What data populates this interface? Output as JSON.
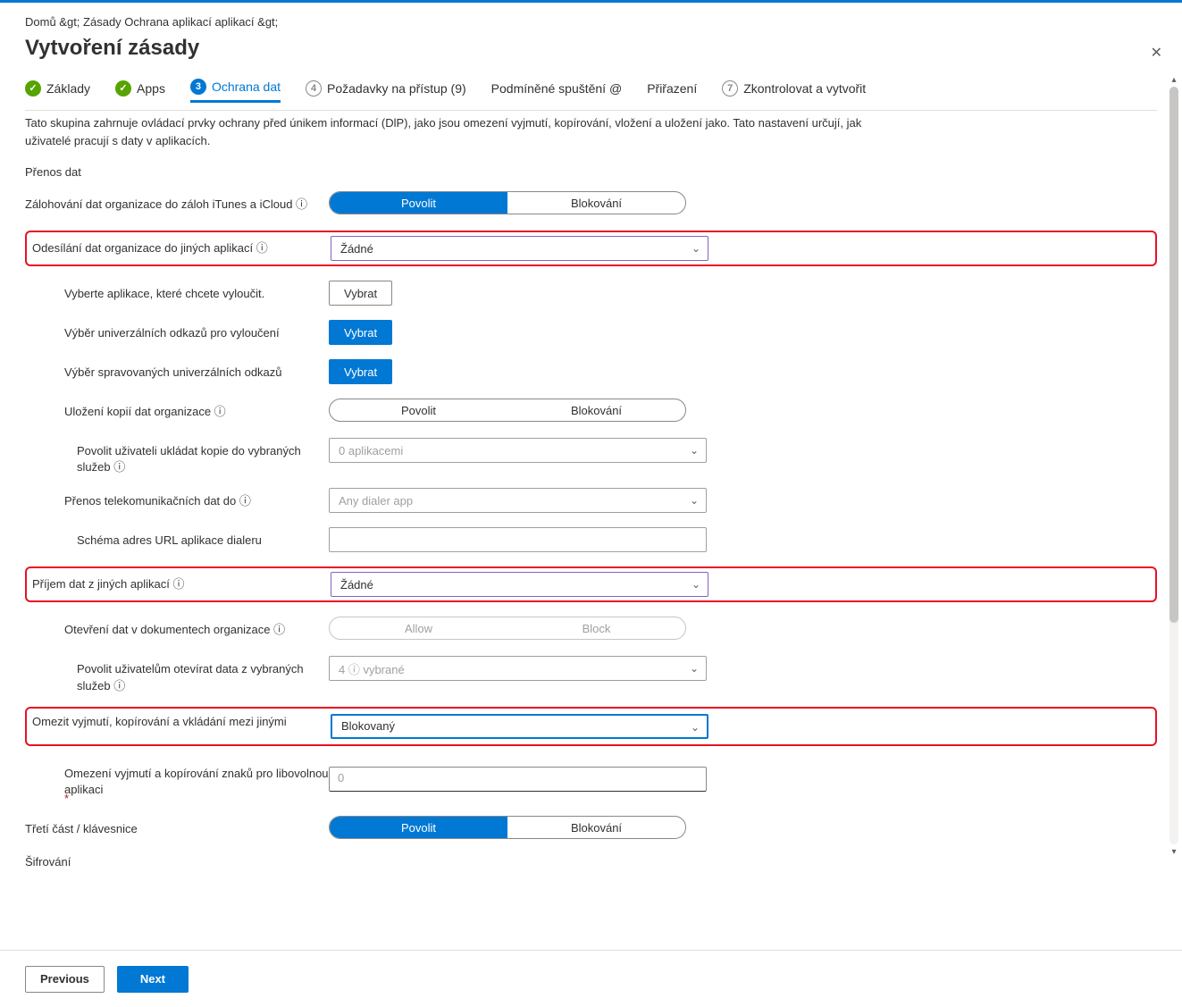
{
  "breadcrumb": {
    "home": "Domů &gt;",
    "policy": "Zásady Ochrana aplikací aplikací &gt;"
  },
  "page": {
    "title": "Vytvoření zásady"
  },
  "tabs": {
    "basics": "Základy",
    "apps": "Apps",
    "dataprot_num": "3",
    "dataprot": "Ochrana dat",
    "access_num": "4",
    "access": "Požadavky na přístup (9)",
    "condlaunch": "Podmíněné spuštění @",
    "assign": "Přiřazení",
    "review_num": "7",
    "review": "Zkontrolovat a vytvořit"
  },
  "body": {
    "description": "Tato skupina zahrnuje ovládací prvky ochrany před únikem informací (DlP), jako jsou omezení vyjmutí, kopírování, vložení a uložení jako. Tato nastavení určují, jak uživatelé pracují s daty v aplikacích.",
    "header_transfer": "Přenos dat",
    "r_backup_label": "Zálohování dat organizace do záloh iTunes a iCloud ⓘ",
    "seg_allow": "Povolit",
    "seg_block": "Blokování",
    "seg_allow_en": "Allow",
    "seg_block_en": "Block",
    "r_send_label": "Odesílání dat organizace do jiných aplikací ⓘ",
    "r_send_value": "Žádné",
    "r_exclude_apps": "Vyberte aplikace, které chcete vyloučit.",
    "btn_select": "Vybrat",
    "r_univ_exclude": "Výběr univerzálních odkazů pro vyloučení",
    "r_univ_managed": "Výběr spravovaných univerzálních odkazů",
    "r_save_copies": "Uložení kopií dat organizace ⓘ",
    "r_allow_save_services": "Povolit uživateli ukládat kopie do vybraných služeb ⓘ",
    "r_allow_save_value": "0 aplikacemi",
    "r_telecom": "Přenos telekomunikačních dat do ⓘ",
    "r_telecom_value": "Any dialer app",
    "r_dialer_scheme": "Schéma adres URL aplikace dialeru",
    "r_receive": "Příjem dat z jiných aplikací    ⓘ",
    "r_receive_value": "Žádné",
    "r_open_org": "Otevření dat v dokumentech organizace ⓘ",
    "r_open_services": "Povolit uživatelům otevírat data z vybraných služeb   ⓘ",
    "r_open_services_value": "4 ⓘ vybrané",
    "r_restrict_ccp": "Omezit vyjmutí, kopírování a vkládání mezi jinými",
    "r_restrict_ccp_value": "Blokovaný",
    "r_char_limit": "Omezení vyjmutí a kopírování znaků pro libovolnou aplikaci",
    "r_char_limit_value": "0",
    "star": "*",
    "r_third_kbd": "Třetí část / klávesnice",
    "r_encrypt": "Šifrování"
  },
  "footer": {
    "prev": "Previous",
    "next": "Next"
  }
}
